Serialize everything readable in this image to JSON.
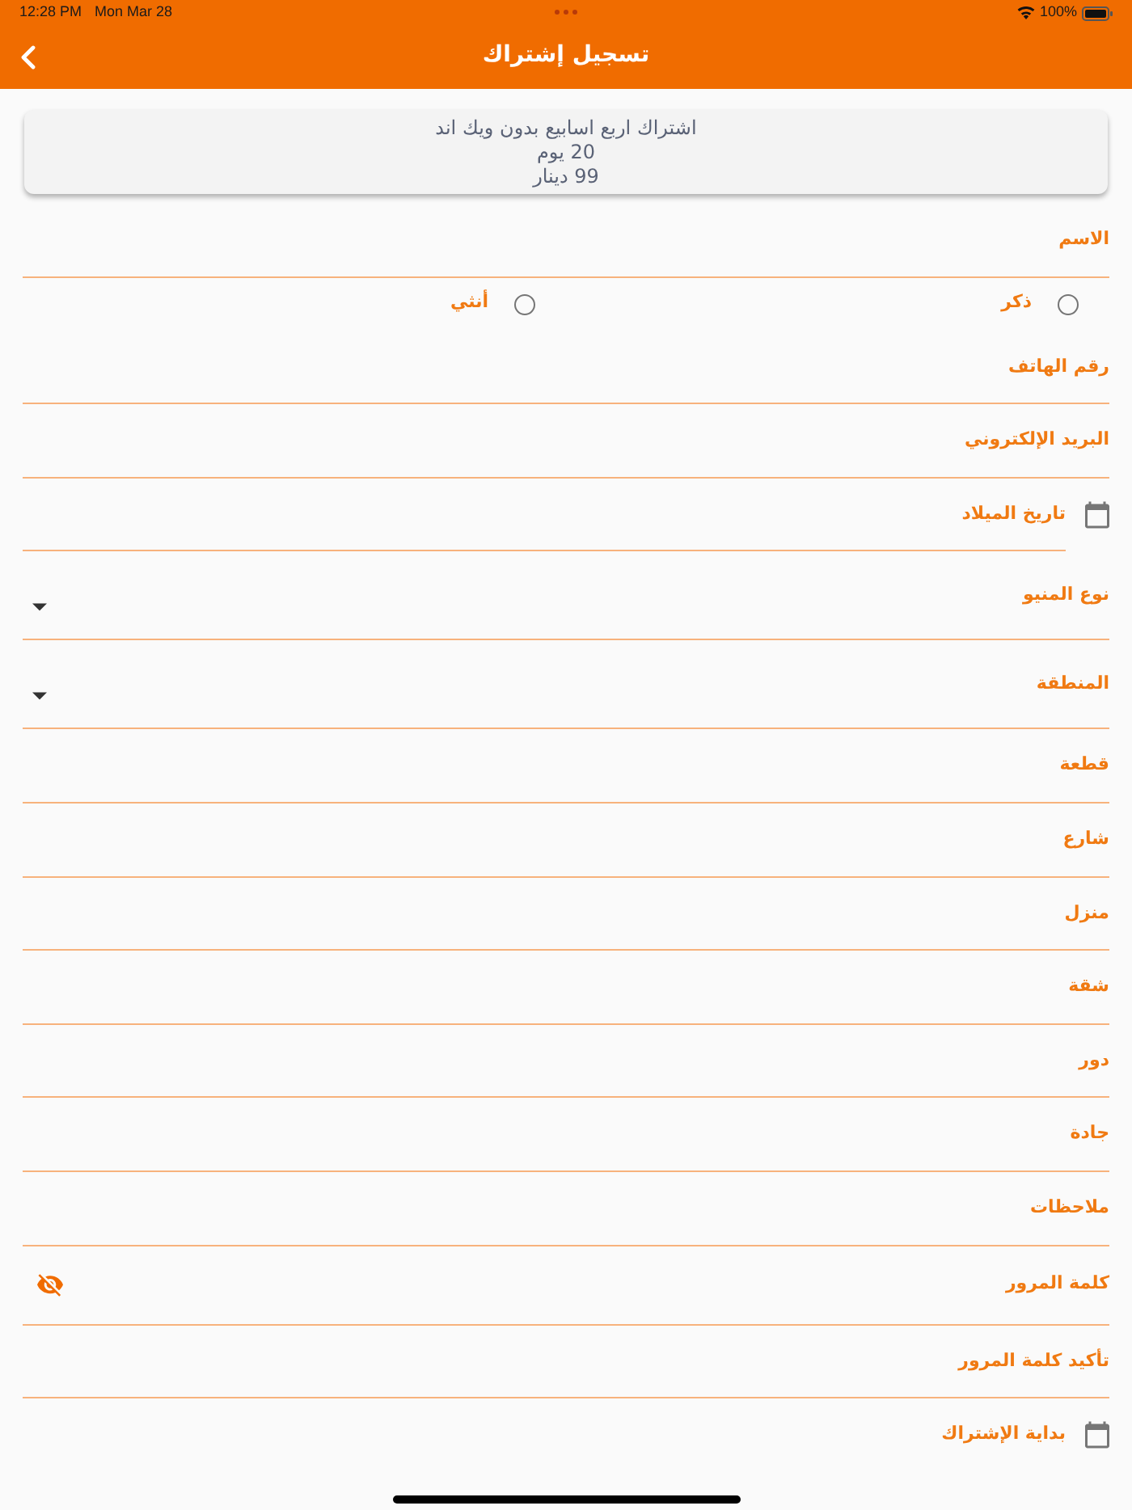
{
  "status_bar": {
    "time": "12:28 PM",
    "date": "Mon Mar 28",
    "battery": "100%"
  },
  "app_bar": {
    "title": "تسجيل إشتراك"
  },
  "plan_card": {
    "lines": [
      "اشتراك اربع اسابيع بدون ويك اند",
      "20 يوم",
      "99 دينار"
    ]
  },
  "fields": [
    {
      "kind": "text",
      "label": "الاسم"
    },
    {
      "kind": "radio",
      "options": [
        {
          "label": "ذكر",
          "selected": false
        },
        {
          "label": "أنثي",
          "selected": false
        }
      ]
    },
    {
      "kind": "text",
      "label": "رقم الهاتف"
    },
    {
      "kind": "text",
      "label": "البريد الإلكتروني"
    },
    {
      "kind": "date",
      "label": "تاريخ الميلاد"
    },
    {
      "kind": "dropdown",
      "label": "نوع المنيو"
    },
    {
      "kind": "dropdown",
      "label": "المنطقة"
    },
    {
      "kind": "text",
      "label": "قطعة"
    },
    {
      "kind": "text",
      "label": "شارع"
    },
    {
      "kind": "text",
      "label": "منزل"
    },
    {
      "kind": "text",
      "label": "شقة"
    },
    {
      "kind": "text",
      "label": "دور"
    },
    {
      "kind": "text",
      "label": "جادة"
    },
    {
      "kind": "text",
      "label": "ملاحظات"
    },
    {
      "kind": "password",
      "label": "كلمة المرور",
      "obscured": true
    },
    {
      "kind": "text",
      "label": "تأكيد كلمة المرور"
    },
    {
      "kind": "date",
      "label": "بداية الإشتراك"
    }
  ]
}
